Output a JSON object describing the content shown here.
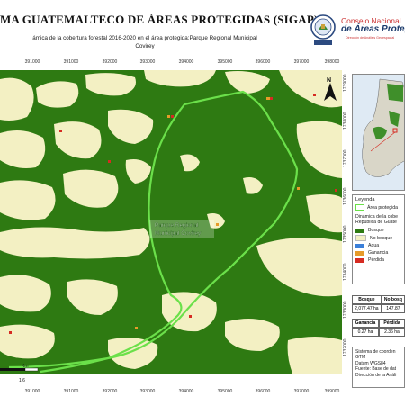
{
  "header": {
    "title": "MA GUATEMALTECO DE ÁREAS PROTEGIDAS  (SIGAP)",
    "subtitle_line1": "ámica de la cobertura forestal 2016-2020 en el área protegida:Parque Regional Municipal",
    "subtitle_line2": "Covirey",
    "logo_line1": "Consejo Nacional",
    "logo_line2": "de Áreas Protegid",
    "logo_line3": "Dirección de Análisis Geoespacial"
  },
  "map": {
    "area_label_line1": "Parque Regional",
    "area_label_line2": "Municipal Covirey",
    "north_symbol": "N",
    "scale_label": "Km",
    "scale_value": "1,6",
    "x_ticks": [
      "391000",
      "391000",
      "392000",
      "393000",
      "394000",
      "395000",
      "396000",
      "397000",
      "398000",
      "399000"
    ],
    "y_ticks": [
      "1739000",
      "1738000",
      "1737000",
      "1736000",
      "1735000",
      "1734000",
      "1733000",
      "1732000",
      "1731000",
      "1730000"
    ]
  },
  "legend": {
    "title": "Leyenda",
    "area_item": "Área protegida",
    "dynamics_title_1": "Dinámica de la cobe",
    "dynamics_title_2": "República de Guate",
    "items": [
      {
        "label": "Bosque",
        "color": "#2e7a12"
      },
      {
        "label": "No bosque",
        "color": "#f3f0c3"
      },
      {
        "label": "Agua",
        "color": "#3b7fd9"
      },
      {
        "label": "Ganancia",
        "color": "#e69b2a"
      },
      {
        "label": "Pérdida",
        "color": "#d62b22"
      }
    ]
  },
  "stats": {
    "h_bosque": "Bosque",
    "h_nobosque": "No bosq",
    "v_bosque": "2,077.47 ha",
    "v_nobosque": "147.87",
    "h_ganancia": "Ganancia",
    "h_perdida": "Pérdida",
    "v_ganancia": "0.27 ha",
    "v_perdida": "2.36 ha"
  },
  "notes": {
    "line1": "Sistema de coorden",
    "line2": "GTM",
    "line3": "Datum WGS84",
    "line4": "Fuente: Base de dat",
    "line5": "Dirección de la Análi"
  },
  "colors": {
    "forest": "#2e7a12",
    "nonforest": "#f3f0c3",
    "boundary": "#6be04a",
    "loss": "#d62b22",
    "gain": "#e69b2a"
  }
}
